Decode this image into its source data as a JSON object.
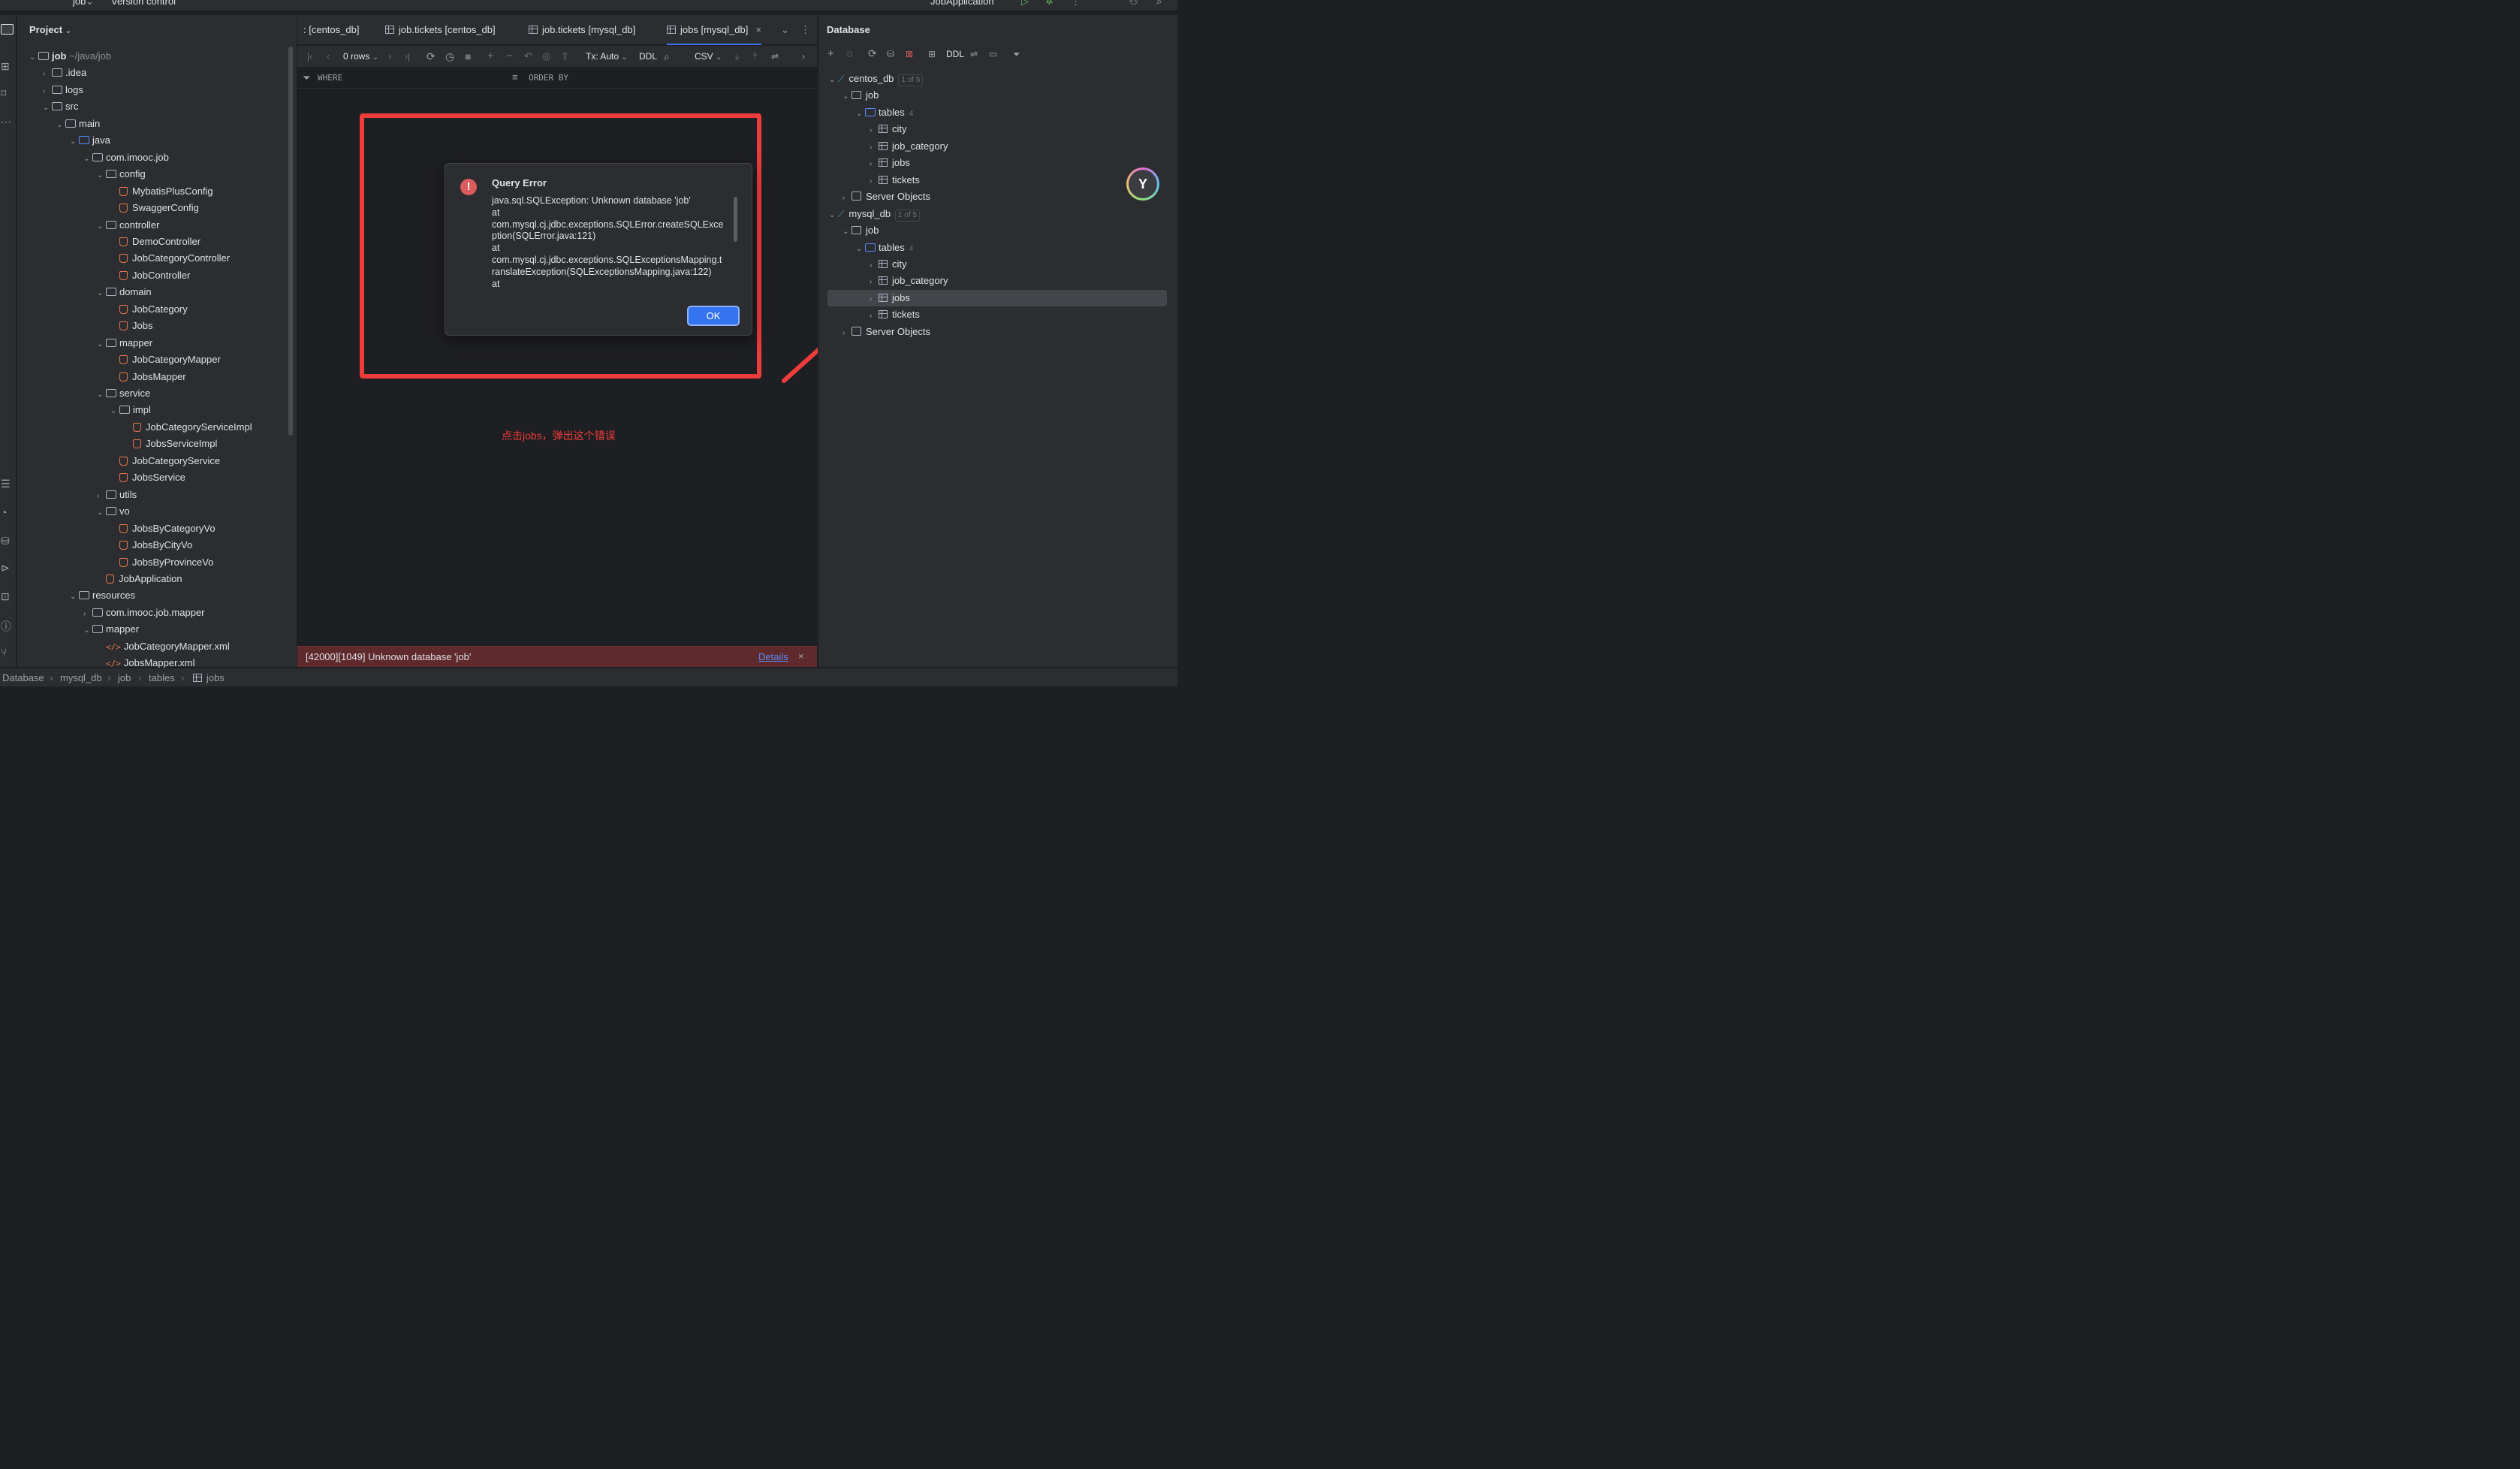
{
  "titlebar": {
    "project": "job",
    "vcs": "Version control",
    "run_config": "JobApplication"
  },
  "project_panel": {
    "title": "Project",
    "tree": [
      {
        "label": "job",
        "suffix": "~/java/job",
        "kind": "module",
        "depth": 0,
        "open": true
      },
      {
        "label": ".idea",
        "kind": "folder",
        "depth": 1,
        "open": false
      },
      {
        "label": "logs",
        "kind": "folder",
        "depth": 1,
        "open": false
      },
      {
        "label": "src",
        "kind": "folder",
        "depth": 1,
        "open": true
      },
      {
        "label": "main",
        "kind": "folder",
        "depth": 2,
        "open": true
      },
      {
        "label": "java",
        "kind": "folder-blue",
        "depth": 3,
        "open": true
      },
      {
        "label": "com.imooc.job",
        "kind": "package",
        "depth": 4,
        "open": true
      },
      {
        "label": "config",
        "kind": "package",
        "depth": 5,
        "open": true
      },
      {
        "label": "MybatisPlusConfig",
        "kind": "class",
        "depth": 6
      },
      {
        "label": "SwaggerConfig",
        "kind": "class",
        "depth": 6
      },
      {
        "label": "controller",
        "kind": "package",
        "depth": 5,
        "open": true
      },
      {
        "label": "DemoController",
        "kind": "class",
        "depth": 6
      },
      {
        "label": "JobCategoryController",
        "kind": "class",
        "depth": 6
      },
      {
        "label": "JobController",
        "kind": "class",
        "depth": 6
      },
      {
        "label": "domain",
        "kind": "package",
        "depth": 5,
        "open": true
      },
      {
        "label": "JobCategory",
        "kind": "class",
        "depth": 6
      },
      {
        "label": "Jobs",
        "kind": "class",
        "depth": 6
      },
      {
        "label": "mapper",
        "kind": "package",
        "depth": 5,
        "open": true
      },
      {
        "label": "JobCategoryMapper",
        "kind": "class",
        "depth": 6
      },
      {
        "label": "JobsMapper",
        "kind": "class",
        "depth": 6
      },
      {
        "label": "service",
        "kind": "package",
        "depth": 5,
        "open": true
      },
      {
        "label": "impl",
        "kind": "package",
        "depth": 6,
        "open": true
      },
      {
        "label": "JobCategoryServiceImpl",
        "kind": "class",
        "depth": 7
      },
      {
        "label": "JobsServiceImpl",
        "kind": "class",
        "depth": 7
      },
      {
        "label": "JobCategoryService",
        "kind": "class",
        "depth": 6
      },
      {
        "label": "JobsService",
        "kind": "class",
        "depth": 6
      },
      {
        "label": "utils",
        "kind": "package",
        "depth": 5,
        "open": false
      },
      {
        "label": "vo",
        "kind": "package",
        "depth": 5,
        "open": true
      },
      {
        "label": "JobsByCategoryVo",
        "kind": "class",
        "depth": 6
      },
      {
        "label": "JobsByCityVo",
        "kind": "class",
        "depth": 6
      },
      {
        "label": "JobsByProvinceVo",
        "kind": "class",
        "depth": 6
      },
      {
        "label": "JobApplication",
        "kind": "class",
        "depth": 5
      },
      {
        "label": "resources",
        "kind": "folder",
        "depth": 3,
        "open": true
      },
      {
        "label": "com.imooc.job.mapper",
        "kind": "folder",
        "depth": 4,
        "open": false
      },
      {
        "label": "mapper",
        "kind": "folder",
        "depth": 4,
        "open": true
      },
      {
        "label": "JobCategoryMapper.xml",
        "kind": "xml",
        "depth": 5
      },
      {
        "label": "JobsMapper.xml",
        "kind": "xml",
        "depth": 5
      }
    ]
  },
  "editor_tabs": [
    {
      "label": ": [centos_db]",
      "active": false
    },
    {
      "label": "job.tickets [centos_db]",
      "active": false
    },
    {
      "label": "job.tickets [mysql_db]",
      "active": false
    },
    {
      "label": "jobs [mysql_db]",
      "active": true
    }
  ],
  "grid_toolbar": {
    "rows": "0 rows",
    "tx": "Tx: Auto",
    "ddl": "DDL",
    "export": "CSV"
  },
  "filter": {
    "where": "WHERE",
    "order_by": "ORDER BY"
  },
  "dialog": {
    "title": "Query Error",
    "message": "java.sql.SQLException: Unknown database 'job'\nat\ncom.mysql.cj.jdbc.exceptions.SQLError.createSQLExce\nption(SQLError.java:121)\nat\ncom.mysql.cj.jdbc.exceptions.SQLExceptionsMapping.t\nranslateException(SQLExceptionsMapping.java:122)\nat",
    "ok": "OK"
  },
  "annotation": {
    "note": "点击jobs，弹出这个错误",
    "color": "#ee3b3b"
  },
  "error_bar": {
    "message": "[42000][1049] Unknown database 'job'",
    "details": "Details"
  },
  "database_panel": {
    "title": "Database",
    "ddl": "DDL",
    "tree": [
      {
        "label": "centos_db",
        "badge": "1 of 5",
        "kind": "datasource",
        "depth": 0,
        "open": true
      },
      {
        "label": "job",
        "kind": "schema",
        "depth": 1,
        "open": true
      },
      {
        "label": "tables",
        "count": "4",
        "kind": "folder",
        "depth": 2,
        "open": true
      },
      {
        "label": "city",
        "kind": "table",
        "depth": 3
      },
      {
        "label": "job_category",
        "kind": "table",
        "depth": 3
      },
      {
        "label": "jobs",
        "kind": "table",
        "depth": 3
      },
      {
        "label": "tickets",
        "kind": "table",
        "depth": 3
      },
      {
        "label": "Server Objects",
        "kind": "server",
        "depth": 1,
        "open": false
      },
      {
        "label": "mysql_db",
        "badge": "1 of 5",
        "kind": "datasource",
        "depth": 0,
        "open": true
      },
      {
        "label": "job",
        "kind": "schema",
        "depth": 1,
        "open": true
      },
      {
        "label": "tables",
        "count": "4",
        "kind": "folder",
        "depth": 2,
        "open": true
      },
      {
        "label": "city",
        "kind": "table",
        "depth": 3
      },
      {
        "label": "job_category",
        "kind": "table",
        "depth": 3
      },
      {
        "label": "jobs",
        "kind": "table",
        "depth": 3,
        "selected": true
      },
      {
        "label": "tickets",
        "kind": "table",
        "depth": 3
      },
      {
        "label": "Server Objects",
        "kind": "server",
        "depth": 1,
        "open": false
      }
    ]
  },
  "breadcrumb": [
    "Database",
    "mysql_db",
    "job",
    "tables",
    "jobs"
  ],
  "colors": {
    "accent": "#3574f0",
    "error": "#db5c5c",
    "annotation": "#ee3b3b"
  }
}
